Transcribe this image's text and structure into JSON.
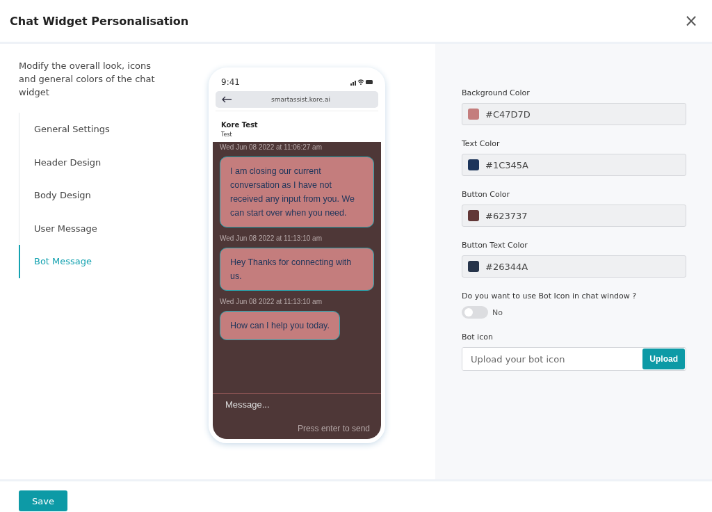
{
  "dialog": {
    "title": "Chat Widget Personalisation",
    "close": "×"
  },
  "description": "Modify the overall look, icons and general colors of the chat widget",
  "nav": [
    {
      "label": "General Settings",
      "selected": false
    },
    {
      "label": "Header Design",
      "selected": false
    },
    {
      "label": "Body Design",
      "selected": false
    },
    {
      "label": "User Message",
      "selected": false
    },
    {
      "label": "Bot Message",
      "selected": true
    }
  ],
  "preview": {
    "time": "9:41",
    "url": "smartassist.kore.ai",
    "bot_name": "Kore Test",
    "bot_subtitle": "Test",
    "messages": [
      {
        "timestamp": "Wed Jun 08 2022 at 11:06:27 am",
        "text": "I am closing our current conversation as I have not received any input from you. We can start over when you need."
      },
      {
        "timestamp": "Wed Jun 08 2022 at 11:13:10 am",
        "text": "Hey Thanks for connecting with us."
      },
      {
        "timestamp": "Wed Jun 08 2022 at 11:13:10 am",
        "text": "How can I help you today."
      }
    ],
    "composer_placeholder": "Message...",
    "send_hint": "Press enter to send"
  },
  "fields": [
    {
      "label": "Background Color",
      "value": "#C47D7D",
      "color": "#c47d7d"
    },
    {
      "label": "Text Color",
      "value": "#1C345A",
      "color": "#1c345a"
    },
    {
      "label": "Button Color",
      "value": "#623737",
      "color": "#623737"
    },
    {
      "label": "Button Text Color",
      "value": "#26344A",
      "color": "#26344a"
    }
  ],
  "bot_icon_toggle": {
    "question": "Do you want to use Bot Icon in chat window ?",
    "on": false,
    "state_label": "No"
  },
  "bot_icon": {
    "label": "Bot icon",
    "placeholder": "Upload your bot icon",
    "button": "Upload"
  },
  "save": "Save"
}
